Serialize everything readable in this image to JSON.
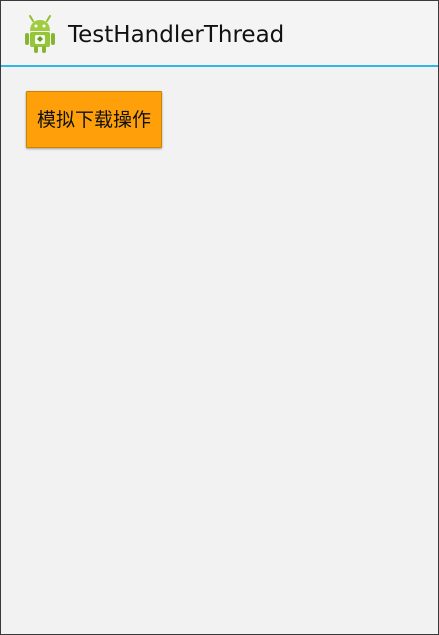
{
  "app_bar": {
    "icon": "android-icon",
    "title": "TestHandlerThread"
  },
  "main": {
    "button_label": "模拟下载操作"
  },
  "colors": {
    "accent": "#33b5e5",
    "button": "#ffa00a",
    "background": "#f2f2f2"
  }
}
